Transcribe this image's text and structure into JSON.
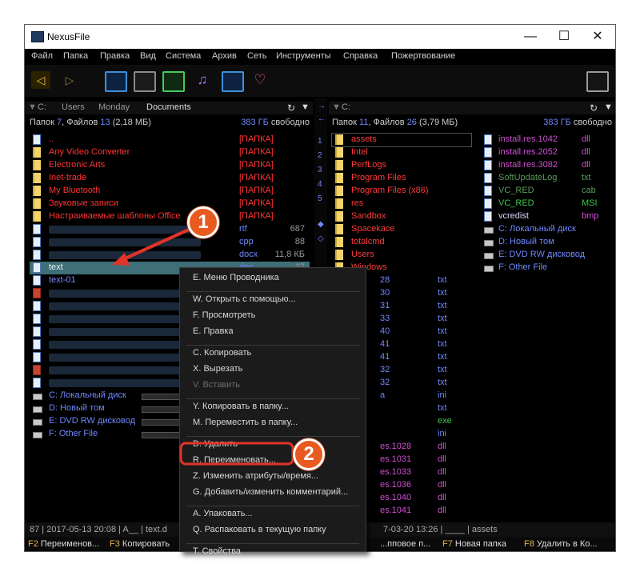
{
  "window": {
    "title": "NexusFile"
  },
  "menu": [
    "Файл",
    "Папка",
    "Правка",
    "Вид",
    "Система",
    "Архив",
    "Сеть",
    "Инструменты",
    "Справка",
    "Пожертвование"
  ],
  "left": {
    "path": [
      "C:",
      "Users",
      "Monday",
      "Documents"
    ],
    "info_pre": "Папок ",
    "folders": "7",
    "info_mid": ", Файлов ",
    "files": "13",
    "size": "(2,18 МБ)",
    "free": "383 ГБ свободно",
    "rows": [
      {
        "name": "..",
        "ext": "[ПАПКА]",
        "size": ""
      },
      {
        "name": "Any Video Converter",
        "ext": "[ПАПКА]",
        "size": ""
      },
      {
        "name": "Electronic Arts",
        "ext": "[ПАПКА]",
        "size": ""
      },
      {
        "name": "Inet-trade",
        "ext": "[ПАПКА]",
        "size": ""
      },
      {
        "name": "My Bluetooth",
        "ext": "[ПАПКА]",
        "size": ""
      },
      {
        "name": "Звуковые записи",
        "ext": "[ПАПКА]",
        "size": ""
      },
      {
        "name": "Настраиваемые шаблоны Office",
        "ext": "[ПАПКА]",
        "size": ""
      },
      {
        "name": "",
        "ext": "rtf",
        "size": "687"
      },
      {
        "name": "",
        "ext": "cpp",
        "size": "88"
      },
      {
        "name": "",
        "ext": "docx",
        "size": "11,8 КБ"
      },
      {
        "name": "text",
        "ext": "doc",
        "size": "27"
      },
      {
        "name": "text-01",
        "ext": "",
        "size": ""
      }
    ],
    "drives": [
      "C: Локальный диск",
      "D: Новый том",
      "E: DVD RW дисковод",
      "F: Other File"
    ],
    "status": "87 | 2017-05-13 20:08 | A__ | text.d"
  },
  "right": {
    "path": [
      "C:"
    ],
    "info_pre": "Папок ",
    "folders": "11",
    "info_mid": ", Файлов ",
    "files": "26",
    "size": "(3,79 МБ)",
    "free": "383 ГБ свободно",
    "folders_list": [
      "assets",
      "Intel",
      "PerfLogs",
      "Program Files",
      "Program Files (x86)",
      "res",
      "Sandbox",
      "Spacekace",
      "totalcmd",
      "Users",
      "Windows"
    ],
    "files_col2": [
      {
        "name": "install.res.1042",
        "ext": "dll"
      },
      {
        "name": "install.res.2052",
        "ext": "dll"
      },
      {
        "name": "install.res.3082",
        "ext": "dll"
      },
      {
        "name": "SoftUpdateLog",
        "ext": "txt"
      },
      {
        "name": "VC_RED",
        "ext": "cab"
      },
      {
        "name": "VC_RED",
        "ext": "MSI"
      },
      {
        "name": "vcredist",
        "ext": "bmp"
      }
    ],
    "drives": [
      "C: Локальный диск",
      "D: Новый том",
      "E: DVD RW дисковод",
      "F: Other File"
    ],
    "partial_rows": [
      {
        "name": "28",
        "ext": "txt"
      },
      {
        "name": "30",
        "ext": "txt"
      },
      {
        "name": "31",
        "ext": "txt"
      },
      {
        "name": "33",
        "ext": "txt"
      },
      {
        "name": "40",
        "ext": "txt"
      },
      {
        "name": "41",
        "ext": "txt"
      },
      {
        "name": "41",
        "ext": "txt"
      },
      {
        "name": "32",
        "ext": "txt"
      },
      {
        "name": "32",
        "ext": "txt"
      },
      {
        "name": "a",
        "ext": "ini"
      },
      {
        "name": "",
        "ext": "txt"
      },
      {
        "name": "",
        "ext": "exe"
      },
      {
        "name": "",
        "ext": "ini"
      },
      {
        "name": "es.1028",
        "ext": "dll"
      },
      {
        "name": "es.1031",
        "ext": "dll"
      },
      {
        "name": "es.1033",
        "ext": "dll"
      },
      {
        "name": "es.1036",
        "ext": "dll"
      },
      {
        "name": "es.1040",
        "ext": "dll"
      },
      {
        "name": "es.1041",
        "ext": "dll"
      }
    ],
    "status": "7-03-20 13:26 | ____ | assets"
  },
  "midnums": [
    "1",
    "2",
    "3",
    "4",
    "5"
  ],
  "context_menu": [
    {
      "label": "E. Меню Проводника",
      "enabled": true
    },
    {
      "sep": true
    },
    {
      "label": "W. Открыть с помощью...",
      "enabled": true
    },
    {
      "label": "F. Просмотреть",
      "enabled": true
    },
    {
      "label": "E. Правка",
      "enabled": true
    },
    {
      "sep": true
    },
    {
      "label": "C. Копировать",
      "enabled": true
    },
    {
      "label": "X. Вырезать",
      "enabled": true
    },
    {
      "label": "V. Вставить",
      "enabled": false
    },
    {
      "sep": true
    },
    {
      "label": "Y. Копировать в папку...",
      "enabled": true
    },
    {
      "label": "M. Переместить в папку...",
      "enabled": true
    },
    {
      "sep": true
    },
    {
      "label": "D. Удалить",
      "enabled": true
    },
    {
      "label": "R. Переименовать...",
      "enabled": true
    },
    {
      "label": "Z. Изменить атрибуты/время...",
      "enabled": true
    },
    {
      "label": "G. Добавить/изменить комментарий...",
      "enabled": true
    },
    {
      "sep": true
    },
    {
      "label": "A. Упаковать...",
      "enabled": true
    },
    {
      "label": "Q. Распаковать в текущую папку",
      "enabled": true
    },
    {
      "sep": true
    },
    {
      "label": "T. Свойства",
      "enabled": true
    }
  ],
  "fkeys": [
    {
      "key": "F2",
      "label": "Переименов..."
    },
    {
      "key": "F3",
      "label": "Копировать"
    },
    {
      "key": "",
      "label": "...пповое п..."
    },
    {
      "key": "F7",
      "label": "Новая папка"
    },
    {
      "key": "F8",
      "label": "Удалить в Ко..."
    }
  ],
  "callouts": [
    "1",
    "2"
  ],
  "colors": {
    "folder": "#ff3333",
    "folder_dim": "#cc2b2b",
    "right_folder": "#ff3b3b",
    "dll": "#d14fd1",
    "file": "#7b8cff",
    "accent": "#e85a1f"
  }
}
